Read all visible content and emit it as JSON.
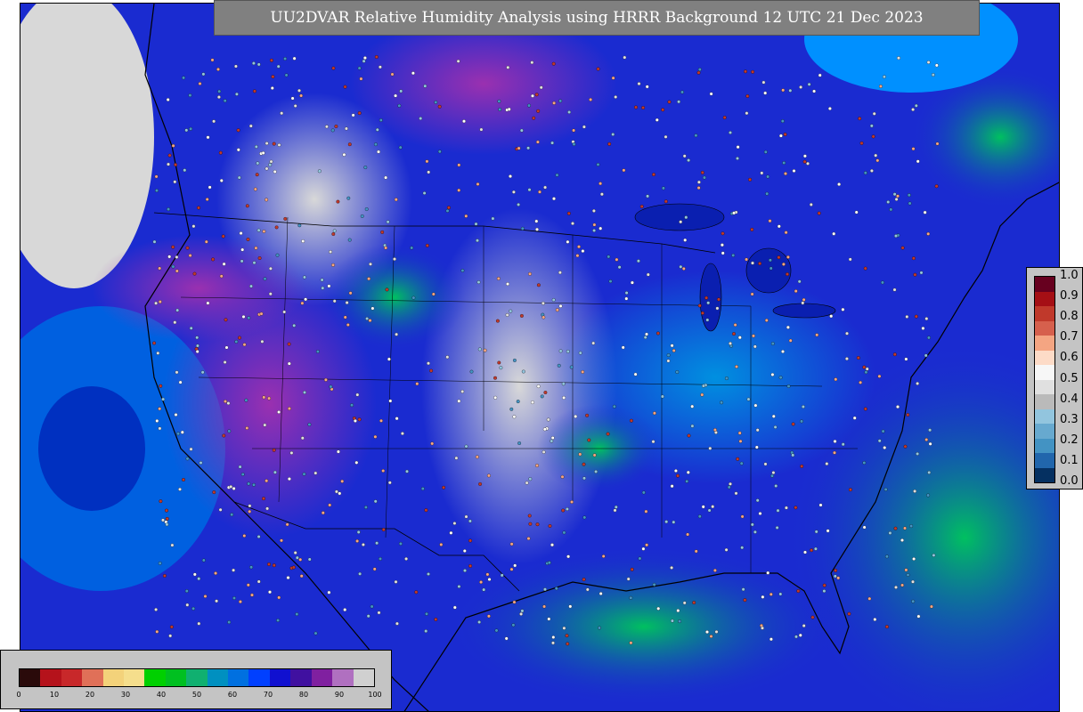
{
  "title": "UU2DVAR Relative Humidity Analysis using HRRR Background 12 UTC 21 Dec 2023",
  "rh_colorbar": {
    "ticks": [
      "0",
      "10",
      "20",
      "30",
      "40",
      "50",
      "60",
      "70",
      "80",
      "90",
      "100"
    ],
    "colors": [
      "#2a0a0a",
      "#b5121b",
      "#c8282a",
      "#e07058",
      "#f3d27a",
      "#f5de8c",
      "#00d000",
      "#00c020",
      "#10b070",
      "#0090c0",
      "#0070e0",
      "#0040ff",
      "#1010d0",
      "#4010a0",
      "#8020a0",
      "#b070c0",
      "#d0d0d0"
    ]
  },
  "residual_colorbar": {
    "ticks": [
      "1.0",
      "0.9",
      "0.8",
      "0.7",
      "0.6",
      "0.5",
      "0.4",
      "0.3",
      "0.2",
      "0.1",
      "0.0"
    ],
    "colors": [
      "#67001f",
      "#a50f15",
      "#c0392b",
      "#d6604d",
      "#f4a582",
      "#fddbc7",
      "#f7f7f7",
      "#e0e0e0",
      "#bababa",
      "#92c5de",
      "#67a9cf",
      "#4393c3",
      "#2166ac",
      "#053061"
    ]
  }
}
